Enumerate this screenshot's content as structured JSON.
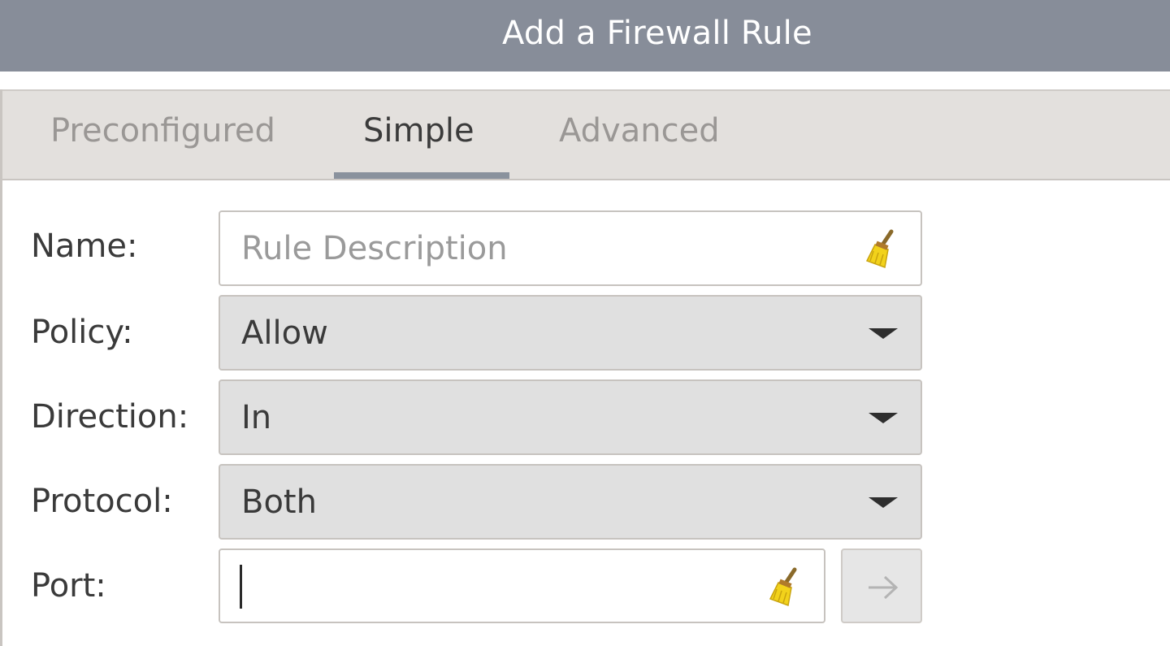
{
  "window": {
    "title": "Add a Firewall Rule"
  },
  "tabs": [
    {
      "label": "Preconfigured",
      "active": false
    },
    {
      "label": "Simple",
      "active": true
    },
    {
      "label": "Advanced",
      "active": false
    }
  ],
  "form": {
    "name": {
      "label": "Name:",
      "placeholder": "Rule Description",
      "value": "",
      "clear_icon": "broom-clear-icon"
    },
    "policy": {
      "label": "Policy:",
      "selected": "Allow"
    },
    "direction": {
      "label": "Direction:",
      "selected": "In"
    },
    "protocol": {
      "label": "Protocol:",
      "selected": "Both"
    },
    "port": {
      "label": "Port:",
      "value": "",
      "clear_icon": "broom-clear-icon",
      "go_icon": "arrow-right-icon"
    }
  },
  "colors": {
    "titlebar": "#878d99",
    "tabbar": "#e3e0dd",
    "active_tab_underline": "#8a929d",
    "combo_background": "#e0e0e0",
    "broom_yellow": "#f2d21b"
  }
}
